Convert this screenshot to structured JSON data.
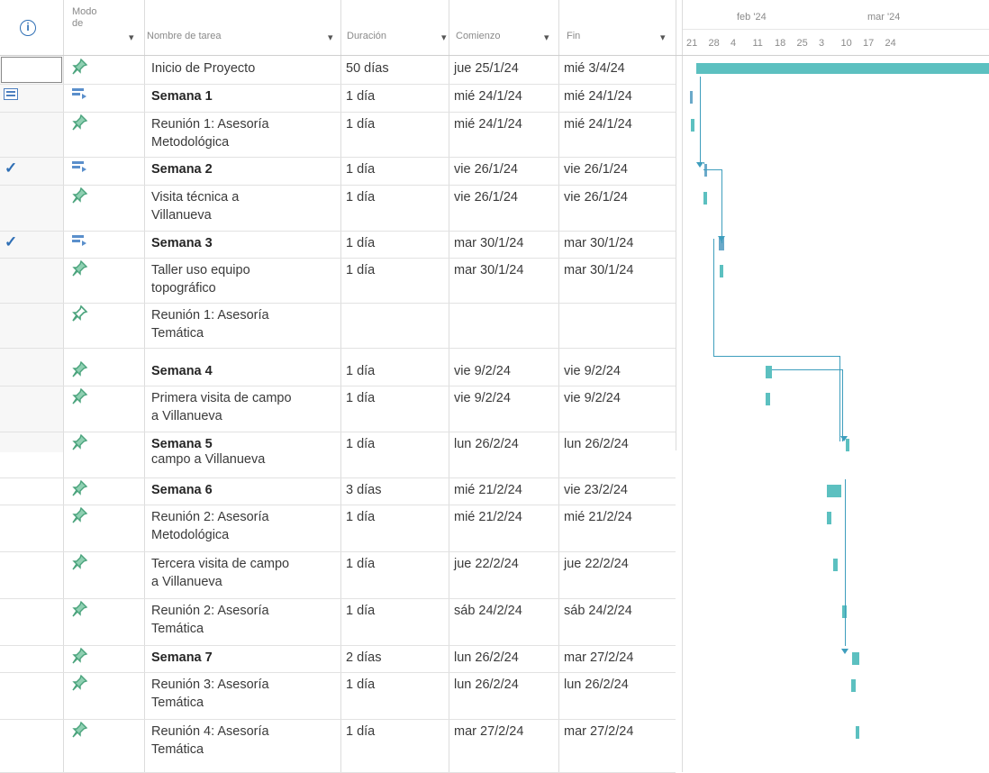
{
  "header": {
    "col_info_icon": "info-icon",
    "col_mode_line1": "Modo",
    "col_mode_line2": "de",
    "col_name": "Nombre de tarea",
    "col_duration": "Duración",
    "col_start": "Comienzo",
    "col_end": "Fin",
    "timescale_months": [
      {
        "label": "feb '24"
      },
      {
        "label": "mar '24"
      }
    ],
    "timescale_days": [
      "21",
      "28",
      "4",
      "11",
      "18",
      "25",
      "3",
      "10",
      "17",
      "24"
    ]
  },
  "rows": [
    {
      "name": "Inicio de Proyecto",
      "duration": "50 días",
      "start": "jue 25/1/24",
      "end": "mié 3/4/24",
      "bold": false,
      "indicator": "",
      "mode_icon": "pin-icon"
    },
    {
      "name": "Semana 1",
      "duration": "1 día",
      "start": "mié 24/1/24",
      "end": "mié 24/1/24",
      "bold": true,
      "indicator": "calendar-icon",
      "mode_icon": "auto-schedule-icon"
    },
    {
      "name": "Reunión 1: Asesoría\nMetodológica",
      "duration": "1 día",
      "start": "mié 24/1/24",
      "end": "mié 24/1/24",
      "bold": false,
      "indicator": "",
      "mode_icon": "pin-icon"
    },
    {
      "name": "Semana 2",
      "duration": "1 día",
      "start": "vie 26/1/24",
      "end": "vie 26/1/24",
      "bold": true,
      "indicator": "check-icon",
      "mode_icon": "auto-schedule-icon"
    },
    {
      "name": "Visita técnica a\nVillanueva",
      "duration": "1 día",
      "start": "vie 26/1/24",
      "end": "vie 26/1/24",
      "bold": false,
      "indicator": "",
      "mode_icon": "pin-icon"
    },
    {
      "name": "Semana 3",
      "duration": "1 día",
      "start": "mar 30/1/24",
      "end": "mar 30/1/24",
      "bold": true,
      "indicator": "check-icon",
      "mode_icon": "auto-schedule-icon"
    },
    {
      "name": "Taller uso equipo\ntopográfico",
      "duration": "1 día",
      "start": "mar 30/1/24",
      "end": "mar 30/1/24",
      "bold": false,
      "indicator": "",
      "mode_icon": "pin-icon"
    },
    {
      "name": "Reunión 1: Asesoría\nTemática",
      "duration": "",
      "start": "",
      "end": "",
      "bold": false,
      "indicator": "",
      "mode_icon": "pin-outline-icon"
    },
    {
      "name": "Semana 4",
      "duration": "1 día",
      "start": "vie 9/2/24",
      "end": "vie 9/2/24",
      "bold": true,
      "indicator": "",
      "mode_icon": "pin-icon"
    },
    {
      "name": "Primera visita de campo\na Villanueva",
      "duration": "1 día",
      "start": "vie 9/2/24",
      "end": "vie 9/2/24",
      "bold": false,
      "indicator": "",
      "mode_icon": "pin-icon"
    },
    {
      "name": "Semana 5",
      "name2": "campo a Villanueva",
      "duration": "1 día",
      "start": "lun 26/2/24",
      "end": "lun 26/2/24",
      "bold": true,
      "indicator": "",
      "mode_icon": "pin-icon"
    },
    {
      "name": "Semana 6",
      "duration": "3 días",
      "start": "mié 21/2/24",
      "end": "vie 23/2/24",
      "bold": true,
      "indicator": "",
      "mode_icon": "pin-icon"
    },
    {
      "name": "Reunión 2: Asesoría\nMetodológica",
      "duration": "1 día",
      "start": "mié 21/2/24",
      "end": "mié 21/2/24",
      "bold": false,
      "indicator": "",
      "mode_icon": "pin-icon"
    },
    {
      "name": "Tercera visita de campo\na Villanueva",
      "duration": "1 día",
      "start": "jue 22/2/24",
      "end": "jue 22/2/24",
      "bold": false,
      "indicator": "",
      "mode_icon": "pin-icon"
    },
    {
      "name": "Reunión 2: Asesoría\nTemática",
      "duration": "1 día",
      "start": "sáb 24/2/24",
      "end": "sáb 24/2/24",
      "bold": false,
      "indicator": "",
      "mode_icon": "pin-icon"
    },
    {
      "name": "Semana 7",
      "duration": "2 días",
      "start": "lun 26/2/24",
      "end": "mar 27/2/24",
      "bold": true,
      "indicator": "",
      "mode_icon": "pin-icon"
    },
    {
      "name": "Reunión 3: Asesoría\nTemática",
      "duration": "1 día",
      "start": "lun 26/2/24",
      "end": "lun 26/2/24",
      "bold": false,
      "indicator": "",
      "mode_icon": "pin-icon"
    },
    {
      "name": "Reunión 4: Asesoría\nTemática",
      "duration": "1 día",
      "start": "mar 27/2/24",
      "end": "mar 27/2/24",
      "bold": false,
      "indicator": "",
      "mode_icon": "pin-icon"
    }
  ],
  "colors": {
    "bar": "#5cc0c0",
    "link": "#3e9ebd",
    "check": "#2f6fb5",
    "pin": "#4aa37c"
  }
}
